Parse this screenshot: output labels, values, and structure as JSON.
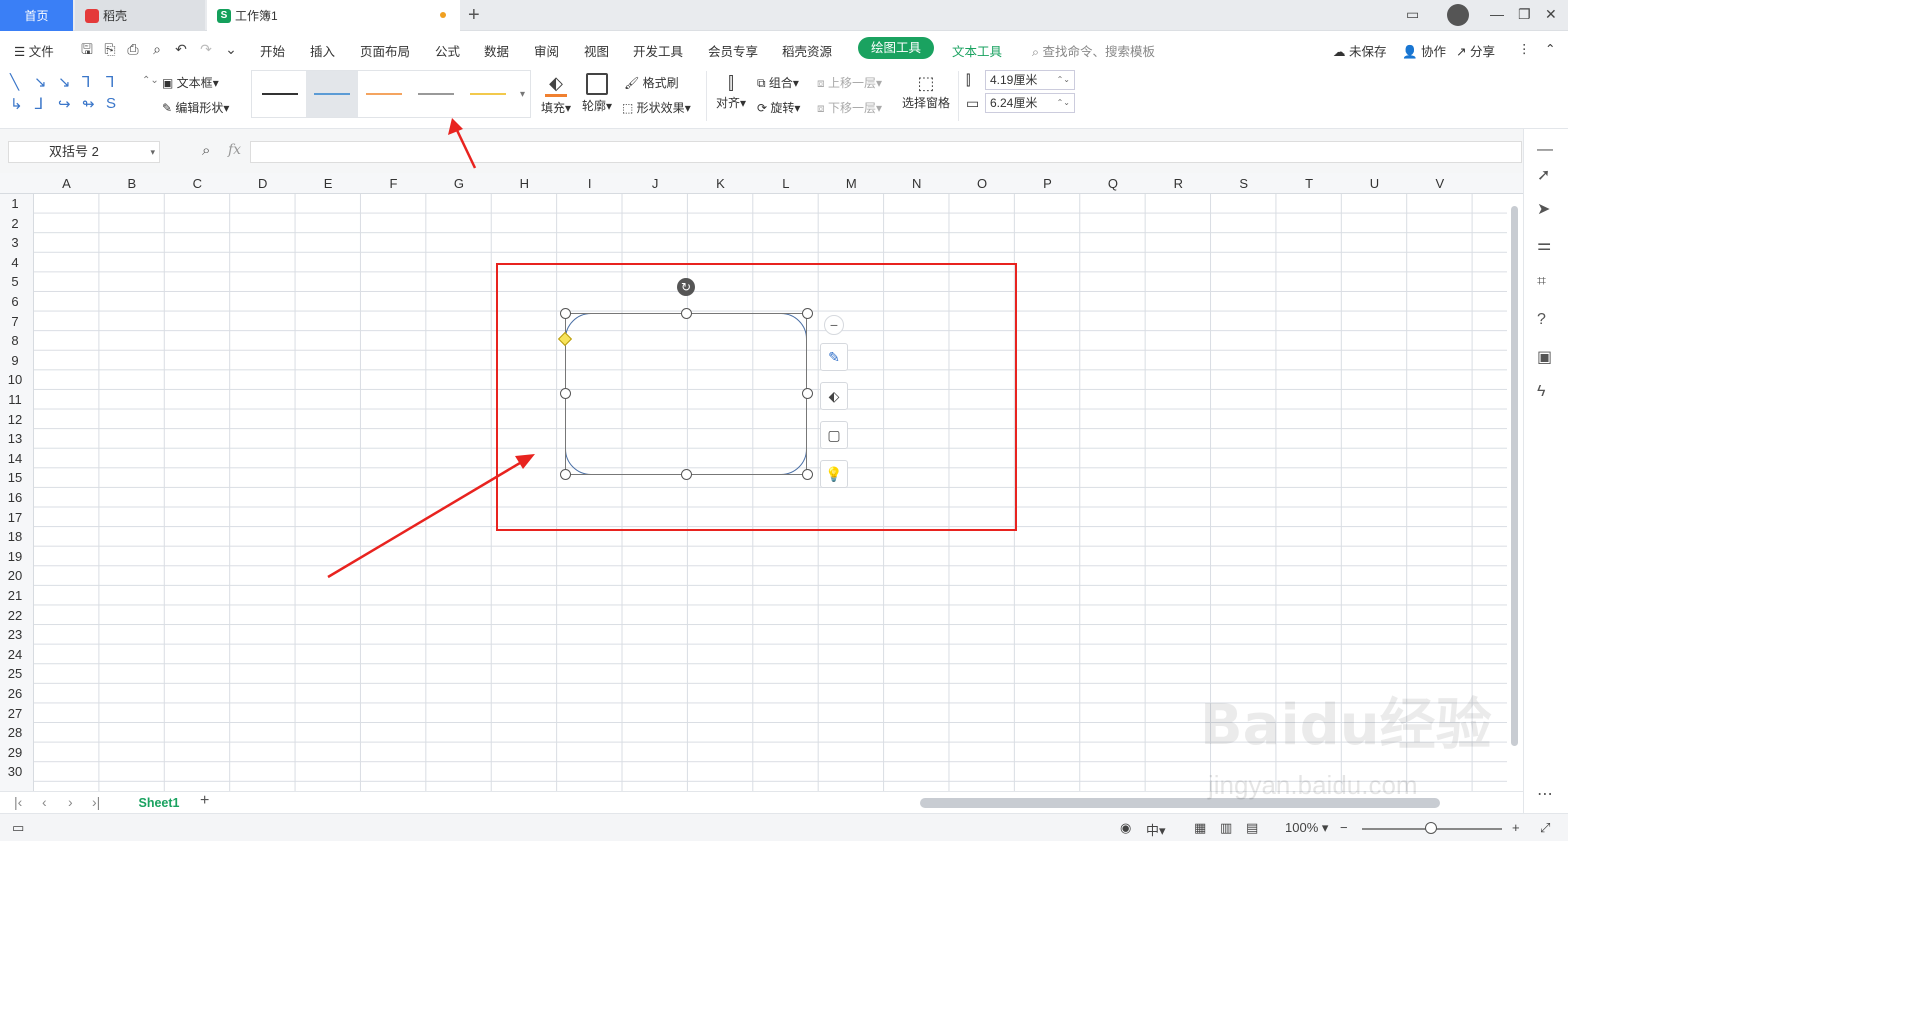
{
  "tabs": {
    "home": "首页",
    "daoke": "稻壳",
    "workbook": "工作簿1"
  },
  "menu": {
    "file": "文件",
    "items": [
      "开始",
      "插入",
      "页面布局",
      "公式",
      "数据",
      "审阅",
      "视图",
      "开发工具",
      "会员专享",
      "稻壳资源"
    ],
    "drawing_tools": "绘图工具",
    "text_tools": "文本工具",
    "search": "查找命令、搜索模板",
    "unsaved": "未保存",
    "collab": "协作",
    "share": "分享"
  },
  "ribbon": {
    "textbox": "文本框",
    "edit_shape": "编辑形状",
    "fill": "填充",
    "outline": "轮廓",
    "format_painter": "格式刷",
    "shape_effects": "形状效果",
    "align": "对齐",
    "group": "组合",
    "rotate": "旋转",
    "bring_forward": "上移一层",
    "send_backward": "下移一层",
    "selection_pane": "选择窗格",
    "height": "4.19厘米",
    "width": "6.24厘米",
    "line_styles": [
      "#333333",
      "#5b9bd5",
      "#f4a460",
      "#999999",
      "#f2c94c"
    ]
  },
  "formula": {
    "name_box": "双括号 2",
    "fx": "fx"
  },
  "columns": [
    "A",
    "B",
    "C",
    "D",
    "E",
    "F",
    "G",
    "H",
    "I",
    "J",
    "K",
    "L",
    "M",
    "N",
    "O",
    "P",
    "Q",
    "R",
    "S",
    "T",
    "U",
    "V"
  ],
  "rows": [
    "1",
    "2",
    "3",
    "4",
    "5",
    "6",
    "7",
    "8",
    "9",
    "10",
    "11",
    "12",
    "13",
    "14",
    "15",
    "16",
    "17",
    "18",
    "19",
    "20",
    "21",
    "22",
    "23",
    "24",
    "25",
    "26",
    "27",
    "28",
    "29",
    "30"
  ],
  "sheet": {
    "name": "Sheet1"
  },
  "status": {
    "zoom": "100%"
  },
  "watermark": {
    "main": "Baidu经验",
    "sub": "jingyan.baidu.com"
  },
  "colors": {
    "accent_green": "#1aa260",
    "tab_blue": "#3a7ff6",
    "annotation_red": "#e8231f"
  }
}
